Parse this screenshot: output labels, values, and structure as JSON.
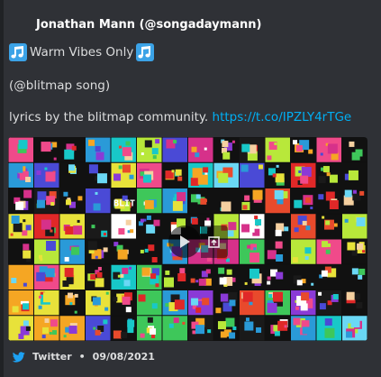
{
  "author": {
    "name": "Jonathan Mann (@songadaymann)"
  },
  "description": {
    "line1": "Warm Vibes Only",
    "line2": "(@blitmap song)",
    "line3_text": "lyrics by the blitmap community. ",
    "line3_link": "https://t.co/IPZLY4rTGe"
  },
  "media": {
    "tile_text": "BLIT",
    "play_icon": "play-icon",
    "open_icon": "open-external-icon"
  },
  "footer": {
    "source": "Twitter",
    "separator": "•",
    "date": "09/08/2021"
  },
  "colors": {
    "background": "#2f3136",
    "link": "#00aff4",
    "twitter_blue": "#1da1f2",
    "note_blue": "#3ba3e7"
  }
}
